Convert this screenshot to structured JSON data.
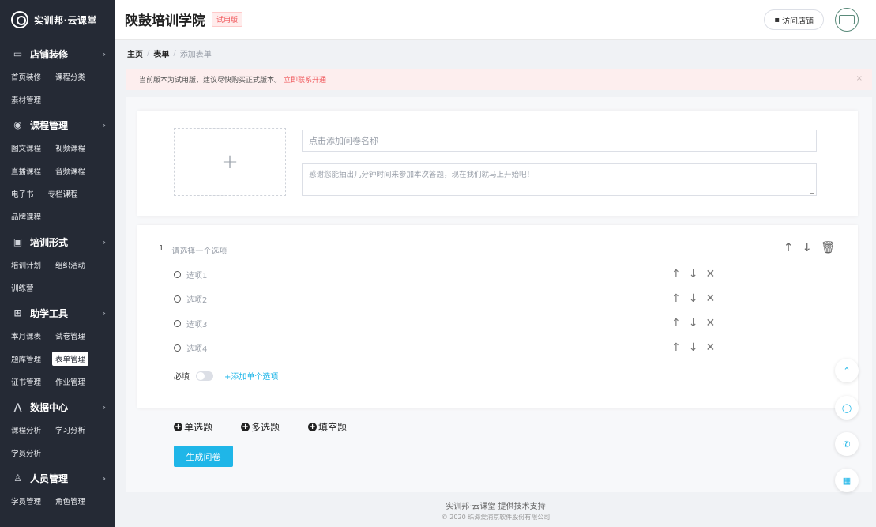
{
  "brand": {
    "logo_text": "实训邦·云课堂"
  },
  "sidebar": {
    "groups": [
      {
        "title": "店铺装修",
        "icon": "store-icon",
        "rows": [
          [
            "首页装修",
            "课程分类"
          ],
          [
            "素材管理"
          ]
        ]
      },
      {
        "title": "课程管理",
        "icon": "course-icon",
        "rows": [
          [
            "图文课程",
            "视频课程"
          ],
          [
            "直播课程",
            "音频课程"
          ],
          [
            "电子书",
            "专栏课程"
          ],
          [
            "品牌课程"
          ]
        ]
      },
      {
        "title": "培训形式",
        "icon": "training-icon",
        "rows": [
          [
            "培训计划",
            "组织活动"
          ],
          [
            "训练营"
          ]
        ]
      },
      {
        "title": "助学工具",
        "icon": "tools-icon",
        "rows": [
          [
            "本月课表",
            "试卷管理"
          ],
          [
            "题库管理",
            "表单管理"
          ],
          [
            "证书管理",
            "作业管理"
          ]
        ]
      },
      {
        "title": "数据中心",
        "icon": "data-icon",
        "rows": [
          [
            "课程分析",
            "学习分析"
          ],
          [
            "学员分析"
          ]
        ]
      },
      {
        "title": "人员管理",
        "icon": "people-icon",
        "rows": [
          [
            "学员管理",
            "角色管理"
          ]
        ]
      }
    ],
    "active_item": "表单管理"
  },
  "header": {
    "school_name": "陕鼓培训学院",
    "trial_badge": "试用版",
    "visit_store": "访问店铺"
  },
  "breadcrumb": {
    "home": "主页",
    "section": "表单",
    "current": "添加表单",
    "separator": "/"
  },
  "alert": {
    "message": "当前版本为试用版，建议尽快购买正式版本。",
    "link": "立即联系开通",
    "close": "×"
  },
  "form": {
    "upload_plus": "+",
    "title_placeholder": "点击添加问卷名称",
    "desc_placeholder": "感谢您能抽出几分钟时间来参加本次答题，现在我们就马上开始吧！"
  },
  "question": {
    "number": "1",
    "title_placeholder": "请选择一个选项",
    "options": [
      "选项1",
      "选项2",
      "选项3",
      "选项4"
    ],
    "required_label": "必填",
    "required": false,
    "add_option": "+添加单个选项"
  },
  "question_types": {
    "single": "单选题",
    "multi": "多选题",
    "fill": "填空题"
  },
  "generate_button": "生成问卷",
  "footer": {
    "line1": "实训邦·云课堂 提供技术支持",
    "line2": "© 2020 珠海爱浦京软件股份有限公司"
  },
  "colors": {
    "sidebar_bg": "#252a35",
    "accent": "#1fb6e8",
    "alert_link": "#f0565a"
  }
}
